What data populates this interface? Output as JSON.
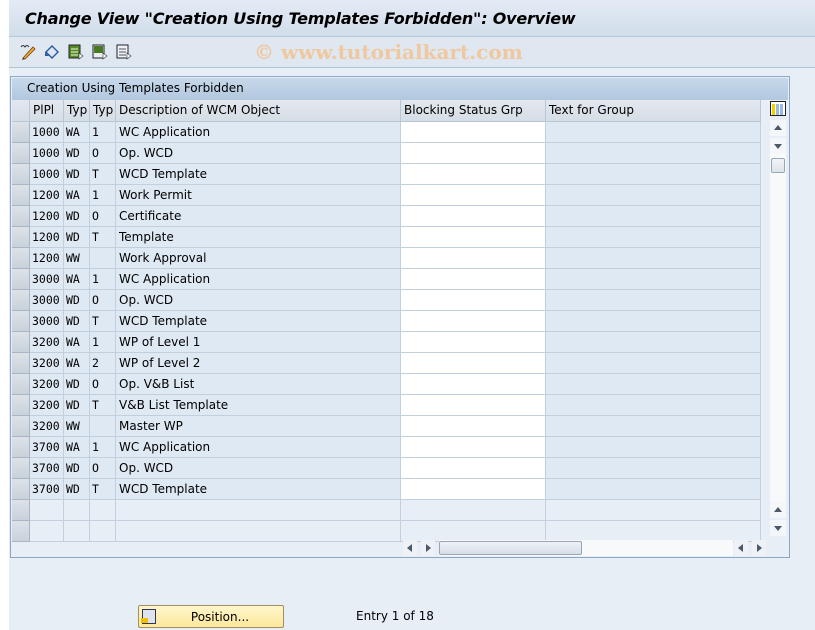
{
  "title": "Change View \"Creation Using Templates Forbidden\": Overview",
  "watermark": "© www.tutorialkart.com",
  "toolbar": {
    "icons": [
      "edit-glasses-icon",
      "undo-changes-icon",
      "select-all-icon",
      "select-block-icon",
      "deselect-all-icon"
    ]
  },
  "table": {
    "title": "Creation Using Templates Forbidden",
    "columns": [
      "PlPl",
      "Typ",
      "Typ",
      "Description of WCM Object",
      "Blocking Status Grp",
      "Text for Group"
    ],
    "rows": [
      {
        "plpl": "1000",
        "typ1": "WA",
        "typ2": "1",
        "desc": "WC Application",
        "blocking": "",
        "text": ""
      },
      {
        "plpl": "1000",
        "typ1": "WD",
        "typ2": "O",
        "desc": "Op. WCD",
        "blocking": "",
        "text": ""
      },
      {
        "plpl": "1000",
        "typ1": "WD",
        "typ2": "T",
        "desc": "WCD Template",
        "blocking": "",
        "text": ""
      },
      {
        "plpl": "1200",
        "typ1": "WA",
        "typ2": "1",
        "desc": "Work Permit",
        "blocking": "",
        "text": ""
      },
      {
        "plpl": "1200",
        "typ1": "WD",
        "typ2": "O",
        "desc": "Certificate",
        "blocking": "",
        "text": ""
      },
      {
        "plpl": "1200",
        "typ1": "WD",
        "typ2": "T",
        "desc": "Template",
        "blocking": "",
        "text": ""
      },
      {
        "plpl": "1200",
        "typ1": "WW",
        "typ2": "",
        "desc": "Work Approval",
        "blocking": "",
        "text": ""
      },
      {
        "plpl": "3000",
        "typ1": "WA",
        "typ2": "1",
        "desc": "WC Application",
        "blocking": "",
        "text": ""
      },
      {
        "plpl": "3000",
        "typ1": "WD",
        "typ2": "O",
        "desc": "Op. WCD",
        "blocking": "",
        "text": ""
      },
      {
        "plpl": "3000",
        "typ1": "WD",
        "typ2": "T",
        "desc": "WCD Template",
        "blocking": "",
        "text": ""
      },
      {
        "plpl": "3200",
        "typ1": "WA",
        "typ2": "1",
        "desc": "WP of Level 1",
        "blocking": "",
        "text": ""
      },
      {
        "plpl": "3200",
        "typ1": "WA",
        "typ2": "2",
        "desc": "WP of Level 2",
        "blocking": "",
        "text": ""
      },
      {
        "plpl": "3200",
        "typ1": "WD",
        "typ2": "O",
        "desc": "Op. V&B List",
        "blocking": "",
        "text": ""
      },
      {
        "plpl": "3200",
        "typ1": "WD",
        "typ2": "T",
        "desc": "V&B List Template",
        "blocking": "",
        "text": ""
      },
      {
        "plpl": "3200",
        "typ1": "WW",
        "typ2": "",
        "desc": "Master WP",
        "blocking": "",
        "text": ""
      },
      {
        "plpl": "3700",
        "typ1": "WA",
        "typ2": "1",
        "desc": "WC Application",
        "blocking": "",
        "text": ""
      },
      {
        "plpl": "3700",
        "typ1": "WD",
        "typ2": "O",
        "desc": "Op. WCD",
        "blocking": "",
        "text": ""
      },
      {
        "plpl": "3700",
        "typ1": "WD",
        "typ2": "T",
        "desc": "WCD Template",
        "blocking": "",
        "text": ""
      }
    ],
    "empty_rows": 2
  },
  "footer": {
    "position_button": "Position...",
    "entry_text": "Entry 1 of 18"
  }
}
